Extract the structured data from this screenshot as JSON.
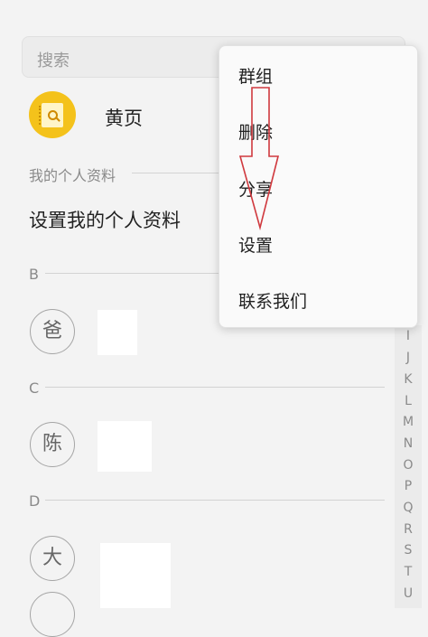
{
  "search": {
    "placeholder": "搜索"
  },
  "yellow_pages": {
    "label": "黄页",
    "icon": "yellow-pages-icon"
  },
  "profile": {
    "section_title": "我的个人资料",
    "setup_label": "设置我的个人资料"
  },
  "contacts": [
    {
      "letter": "B",
      "entries": [
        {
          "avatar_char": "爸"
        }
      ]
    },
    {
      "letter": "C",
      "entries": [
        {
          "avatar_char": "陈"
        }
      ]
    },
    {
      "letter": "D",
      "entries": [
        {
          "avatar_char": "大"
        }
      ]
    }
  ],
  "index_letters": [
    "I",
    "J",
    "K",
    "L",
    "M",
    "N",
    "O",
    "P",
    "Q",
    "R",
    "S",
    "T",
    "U"
  ],
  "menu": {
    "items": [
      {
        "label": "群组"
      },
      {
        "label": "删除"
      },
      {
        "label": "分享"
      },
      {
        "label": "设置"
      },
      {
        "label": "联系我们"
      }
    ]
  },
  "colors": {
    "accent": "#f4c21b",
    "annotation_arrow": "#d0393e"
  }
}
